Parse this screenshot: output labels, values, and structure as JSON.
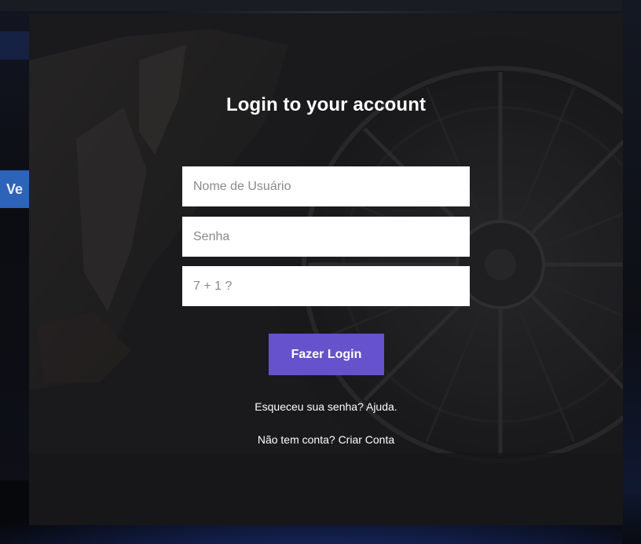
{
  "background": {
    "left_tab_text": "Ve"
  },
  "login": {
    "title": "Login to your account",
    "username_placeholder": "Nome de Usuário",
    "password_placeholder": "Senha",
    "captcha_placeholder": "7 + 1 ?",
    "submit_label": "Fazer Login",
    "forgot_prefix": "Esqueceu sua senha?",
    "forgot_link": "Ajuda.",
    "signup_prefix": "Não tem conta?",
    "signup_link": "Criar Conta"
  },
  "colors": {
    "modal_bg": "#202022",
    "accent": "#6552cc",
    "field_bg": "#ffffff",
    "text": "#ffffff"
  }
}
